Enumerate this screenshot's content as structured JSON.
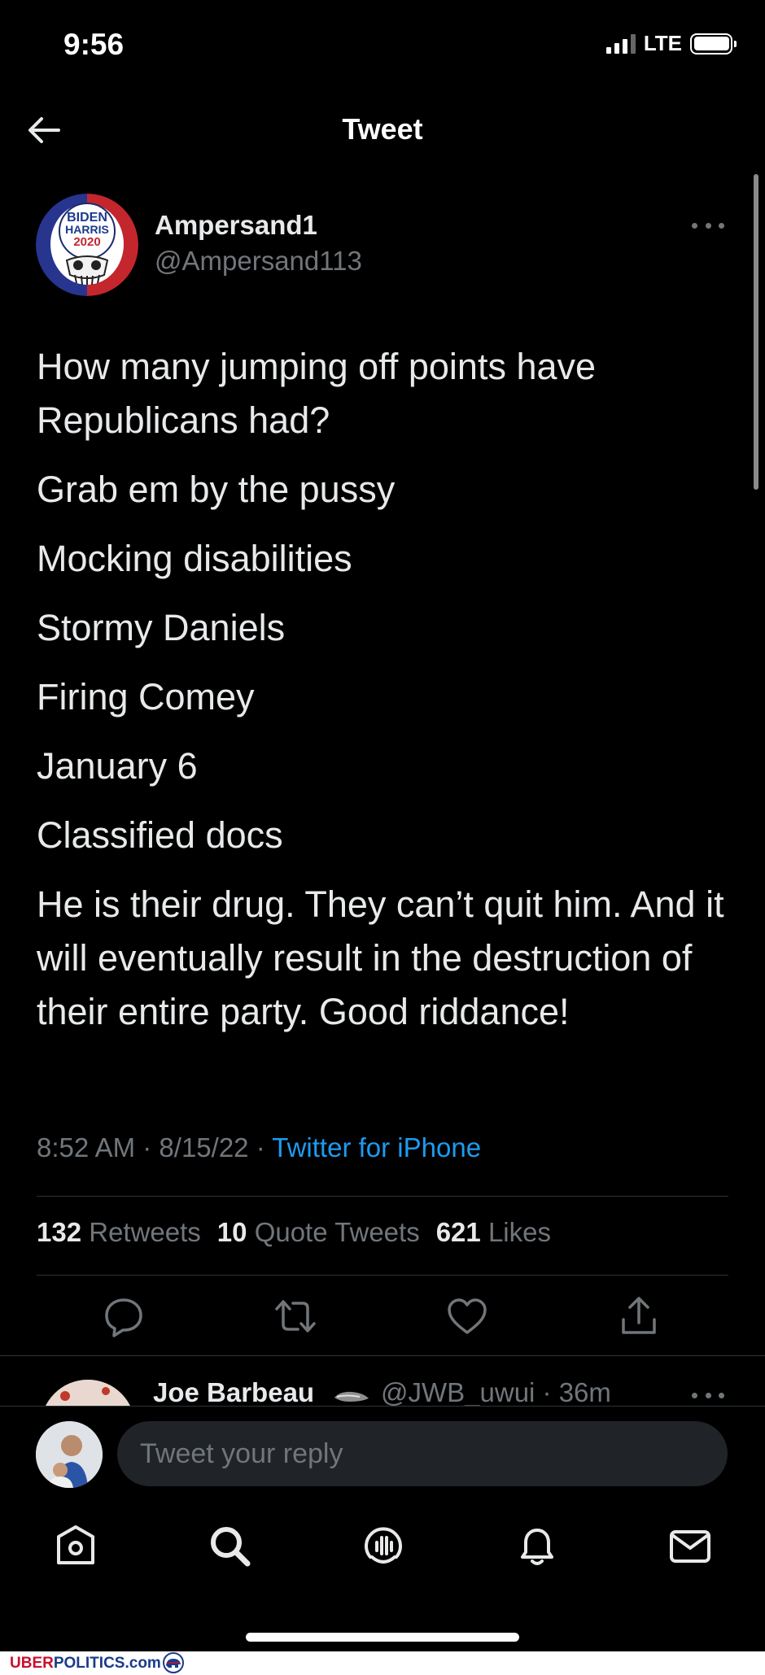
{
  "status_bar": {
    "time": "9:56",
    "network": "LTE"
  },
  "header": {
    "title": "Tweet"
  },
  "tweet": {
    "author_name": "Ampersand1",
    "author_handle": "@Ampersand113",
    "avatar_text": [
      "BIDEN",
      "HARRIS",
      "2020"
    ],
    "paragraphs": [
      "How many jumping off points have Republicans had?",
      "Grab em by the pussy",
      "Mocking disabilities",
      "Stormy Daniels",
      "Firing Comey",
      "January 6",
      "Classified docs",
      "He is their drug. They can’t quit him. And it will eventually result in the destruction of their entire party. Good riddance!"
    ],
    "time": "8:52 AM",
    "date": "8/15/22",
    "source": "Twitter for iPhone",
    "stats": {
      "retweets_count": "132",
      "retweets_label": "Retweets",
      "quotes_count": "10",
      "quotes_label": "Quote Tweets",
      "likes_count": "621",
      "likes_label": "Likes"
    }
  },
  "reply_preview": {
    "name": "Joe Barbeau",
    "handle_time": "@JWB_uwui · 36m"
  },
  "composer": {
    "placeholder": "Tweet your reply"
  },
  "watermark": {
    "brand_a": "UBER",
    "brand_b": "POLITICS",
    "brand_c": ".com"
  },
  "colors": {
    "background": "#000000",
    "text": "#e7e9ea",
    "muted": "#71767b",
    "link": "#1d9bf0",
    "input_bg": "#202327"
  },
  "icons": [
    "back-arrow-icon",
    "more-icon",
    "reply-icon",
    "retweet-icon",
    "like-icon",
    "share-icon",
    "home-icon",
    "search-icon",
    "spaces-icon",
    "notifications-icon",
    "messages-icon"
  ]
}
